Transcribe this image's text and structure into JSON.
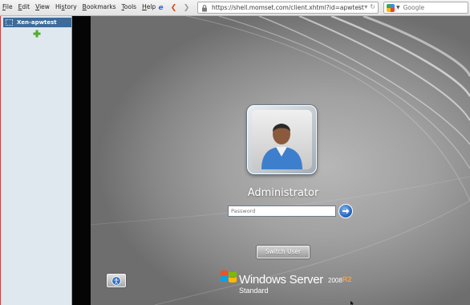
{
  "browser": {
    "menu": [
      {
        "pre": "",
        "key": "F",
        "post": "ile"
      },
      {
        "pre": "",
        "key": "E",
        "post": "dit"
      },
      {
        "pre": "",
        "key": "V",
        "post": "iew"
      },
      {
        "pre": "Hi",
        "key": "s",
        "post": "tory"
      },
      {
        "pre": "",
        "key": "B",
        "post": "ookmarks"
      },
      {
        "pre": "",
        "key": "T",
        "post": "ools"
      },
      {
        "pre": "",
        "key": "H",
        "post": "elp"
      }
    ],
    "url": "https://shell.momset.com/client.xhtml?id=apwtest",
    "search_placeholder": "Google",
    "icons": [
      "ie-icon",
      "back-arrow-icon",
      "forward-arrow-icon",
      "lock-icon",
      "star-icon",
      "dropdown-icon",
      "google-icon"
    ]
  },
  "sidebar": {
    "server_label": "Xen-apwtest",
    "add_icon": "green-plus-icon"
  },
  "login": {
    "username": "Administrator",
    "password_placeholder": "Password",
    "switch_user": "Switch User",
    "brand_name": "Windows Server",
    "brand_version": "2008",
    "brand_release": "R2",
    "brand_edition": "Standard"
  },
  "colors": {
    "sidebar_selected": "#3e6b9a",
    "sidebar_bg": "#dfe7ef",
    "desktop_gray": "#a1a1a1",
    "submit_blue": "#1f5fb6",
    "r2_orange": "#f0a34a"
  }
}
